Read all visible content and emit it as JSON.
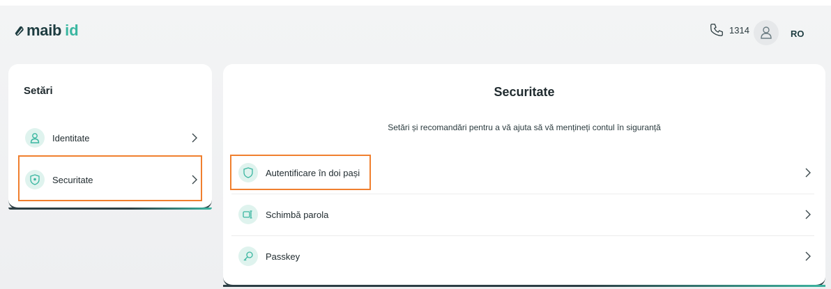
{
  "header": {
    "logo_text": "maib",
    "logo_suffix": "id",
    "phone_number": "1314",
    "language": "RO"
  },
  "sidebar": {
    "title": "Setări",
    "items": [
      {
        "label": "Identitate",
        "icon": "user-icon"
      },
      {
        "label": "Securitate",
        "icon": "shield-icon"
      }
    ]
  },
  "main": {
    "title": "Securitate",
    "subtitle": "Setări și recomandări pentru a vă ajuta să vă mențineți contul în siguranță",
    "items": [
      {
        "label": "Autentificare în doi pași",
        "icon": "shield-outline-icon"
      },
      {
        "label": "Schimbă parola",
        "icon": "password-icon"
      },
      {
        "label": "Passkey",
        "icon": "key-icon"
      }
    ]
  },
  "colors": {
    "accent": "#39b6a0",
    "brand_dark": "#1d3c40",
    "highlight": "#f07f2e",
    "icon_bg": "#dff3ee"
  }
}
